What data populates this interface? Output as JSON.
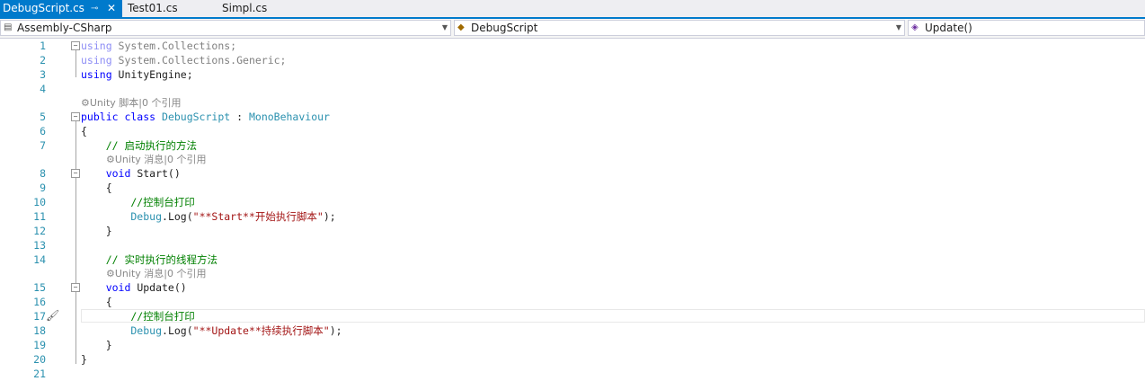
{
  "tabs": [
    {
      "label": "DebugScript.cs",
      "pin": "⊸",
      "close": "✕"
    },
    {
      "label": "Test01.cs"
    },
    {
      "label": "Simpl.cs"
    }
  ],
  "nav": {
    "project": "Assembly-CSharp",
    "class": "DebugScript",
    "member": "Update()"
  },
  "editor": {
    "lens_lines": {
      "class": "Unity 脚本|0 个引用",
      "start": "Unity 消息|0 个引用",
      "update": "Unity 消息|0 个引用"
    },
    "line_numbers": [
      "1",
      "2",
      "3",
      "4",
      "5",
      "6",
      "7",
      "8",
      "9",
      "10",
      "11",
      "12",
      "13",
      "14",
      "15",
      "16",
      "17",
      "18",
      "19",
      "20",
      "21"
    ],
    "code": {
      "l1_kw": "using",
      "l1_ns": " System.Collections;",
      "l2_kw": "using",
      "l2_ns": " System.Collections.Generic;",
      "l3_kw": "using",
      "l3_ns": " UnityEngine;",
      "l5_kw": "public class",
      "l5_name": " DebugScript",
      "l5_colon": " : ",
      "l5_base": "MonoBehaviour",
      "l6": "{",
      "l7": "    // 启动执行的方法",
      "l8_kw": "    void",
      "l8_name": " Start()",
      "l9": "    {",
      "l10": "        //控制台打印",
      "l11_obj": "        Debug",
      "l11_call": ".Log(",
      "l11_str": "\"**Start**开始执行脚本\"",
      "l11_end": ");",
      "l12": "    }",
      "l14": "    // 实时执行的线程方法",
      "l15_kw": "    void",
      "l15_name": " Update()",
      "l16": "    {",
      "l17": "        //控制台打印",
      "l18_obj": "        Debug",
      "l18_call": ".Log(",
      "l18_str": "\"**Update**持续执行脚本\"",
      "l18_end": ");",
      "l19": "    }",
      "l20": "}"
    }
  }
}
